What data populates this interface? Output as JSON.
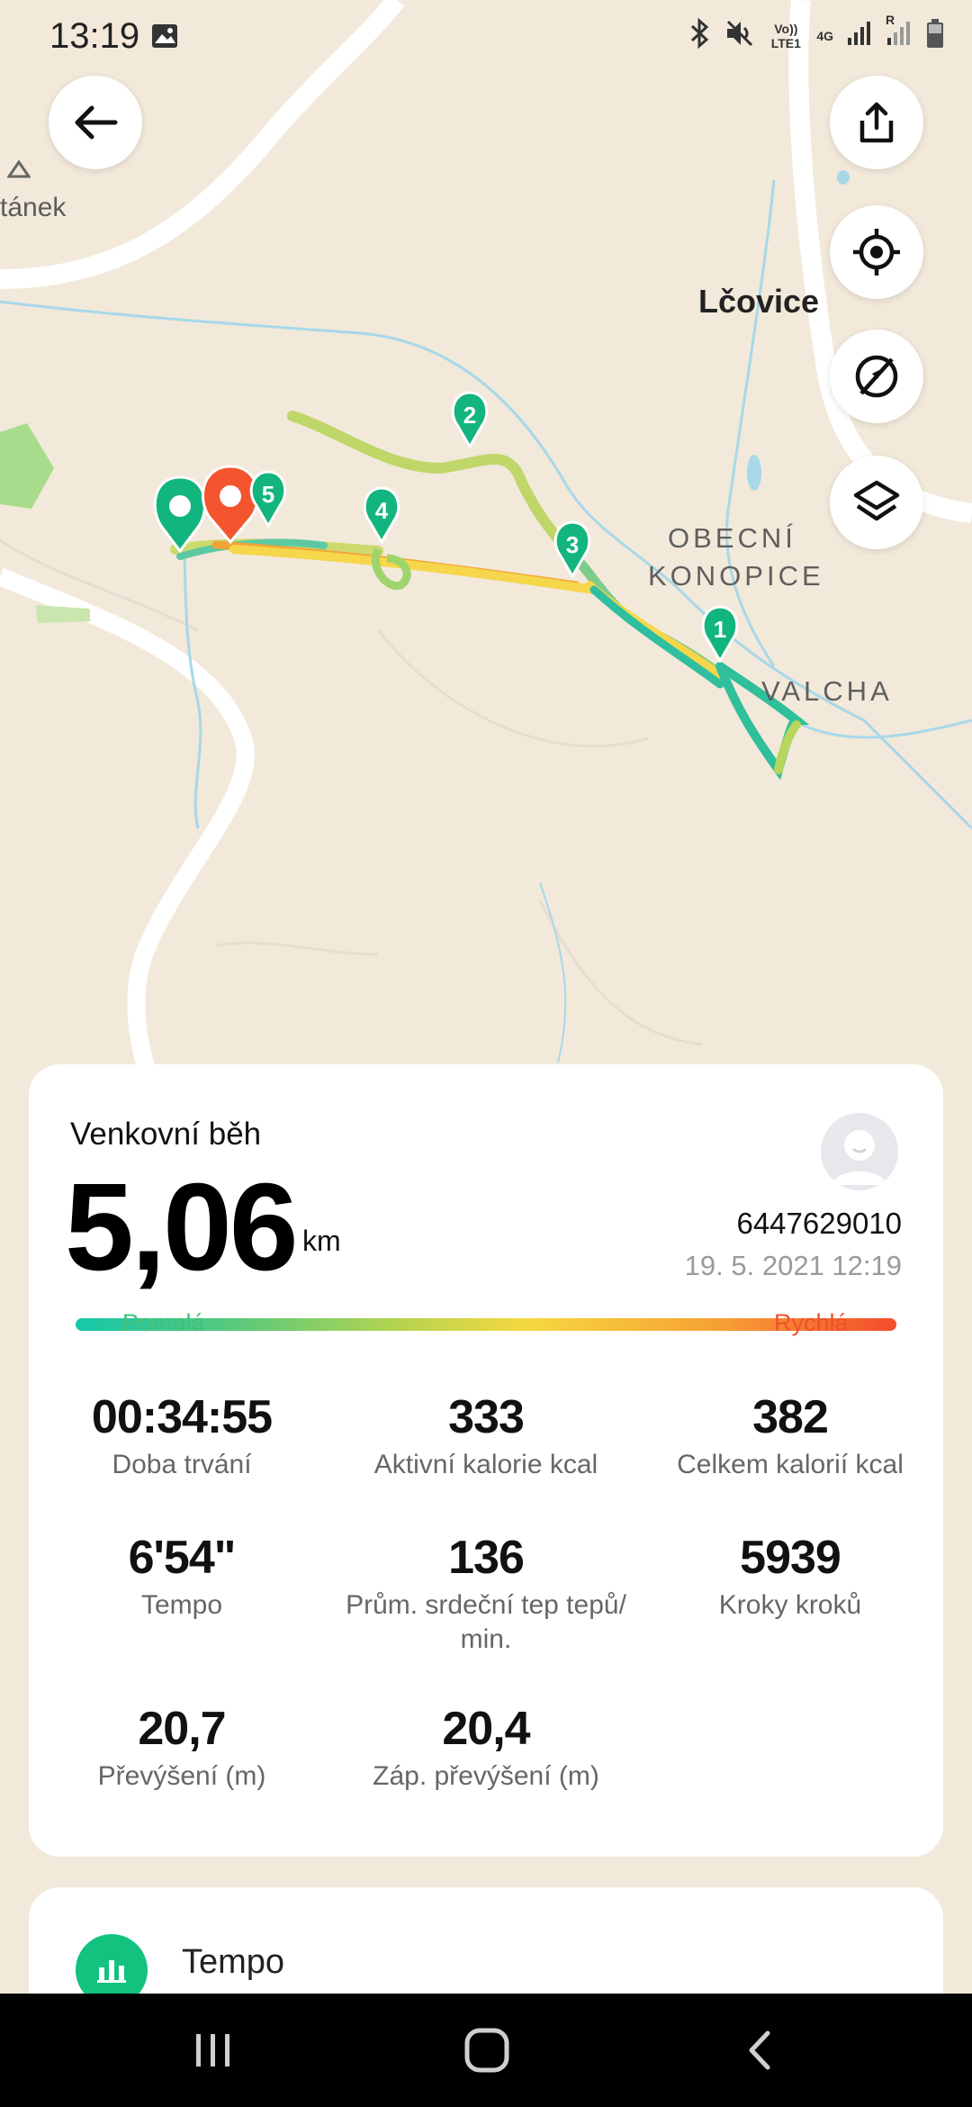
{
  "status_bar": {
    "time": "13:19",
    "network_lte": "Vo)) LTE1",
    "network_4g": "4G",
    "roaming": "R",
    "icons": [
      "image-icon",
      "bluetooth-icon",
      "mute-icon",
      "signal-icon",
      "battery-icon"
    ]
  },
  "map": {
    "town_label": "Lčovice",
    "area_label_1": "OBECNÍ",
    "area_label_2": "KONOPICE",
    "area_label_3": "VALCHA",
    "partial_label": "tánek",
    "markers": [
      "1",
      "2",
      "3",
      "4",
      "5"
    ],
    "buttons": [
      "back-icon",
      "share-icon",
      "locate-icon",
      "hide-route-icon",
      "layers-icon"
    ]
  },
  "summary": {
    "activity_type": "Venkovní běh",
    "distance": "5,06",
    "distance_unit": "km",
    "user_id": "6447629010",
    "datetime": "19. 5. 2021 12:19",
    "speed_slow_label": "Pomalá",
    "speed_fast_label": "Rychlá"
  },
  "metrics": [
    {
      "value": "00:34:55",
      "label": "Doba trvání"
    },
    {
      "value": "333",
      "label": "Aktivní kalorie  kcal"
    },
    {
      "value": "382",
      "label": "Celkem kalorií  kcal"
    },
    {
      "value": "6'54\"",
      "label": "Tempo"
    },
    {
      "value": "136",
      "label": "Prům. srdeční tep  tepů/ min."
    },
    {
      "value": "5939",
      "label": "Kroky  kroků"
    },
    {
      "value": "20,7",
      "label": "Převýšení (m)"
    },
    {
      "value": "20,4",
      "label": "Záp. převýšení (m)"
    }
  ],
  "tempo_section": {
    "label": "Tempo"
  },
  "colors": {
    "accent_green": "#13c27e",
    "marker_orange": "#f4552f",
    "map_bg": "#f2e9da",
    "river": "#a8d8ea"
  }
}
